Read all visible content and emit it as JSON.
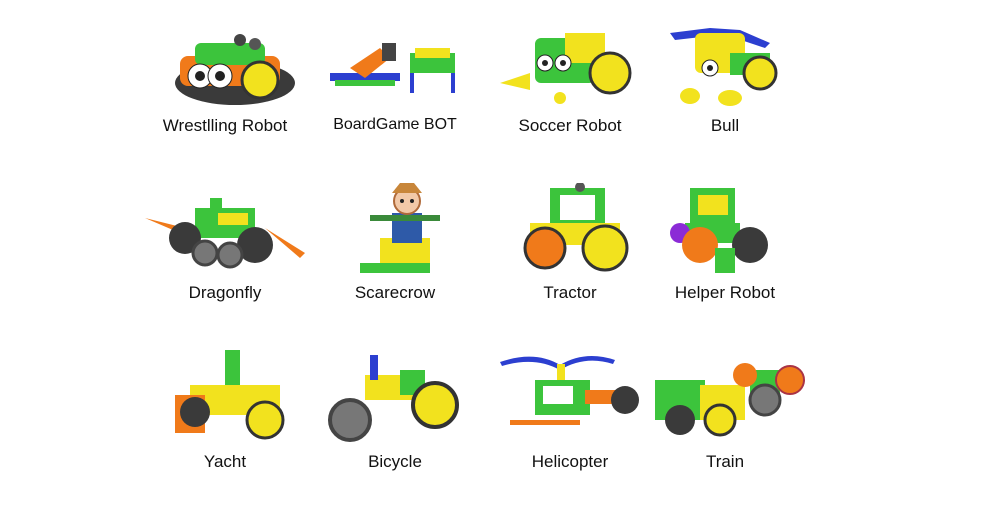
{
  "models": [
    {
      "label": "Wrestlling Robot"
    },
    {
      "label": "BoardGame BOT"
    },
    {
      "label": "Soccer Robot"
    },
    {
      "label": "Bull"
    },
    {
      "label": "Dragonfly"
    },
    {
      "label": "Scarecrow"
    },
    {
      "label": "Tractor"
    },
    {
      "label": "Helper Robot"
    },
    {
      "label": "Yacht"
    },
    {
      "label": "Bicycle"
    },
    {
      "label": "Helicopter"
    },
    {
      "label": "Train"
    }
  ],
  "colors": {
    "green": "#3cc43c",
    "yellow": "#f2e21e",
    "orange": "#f07a1a",
    "dark": "#3a3a3a",
    "blue": "#2c3fd0",
    "purple": "#8b2bd6"
  }
}
